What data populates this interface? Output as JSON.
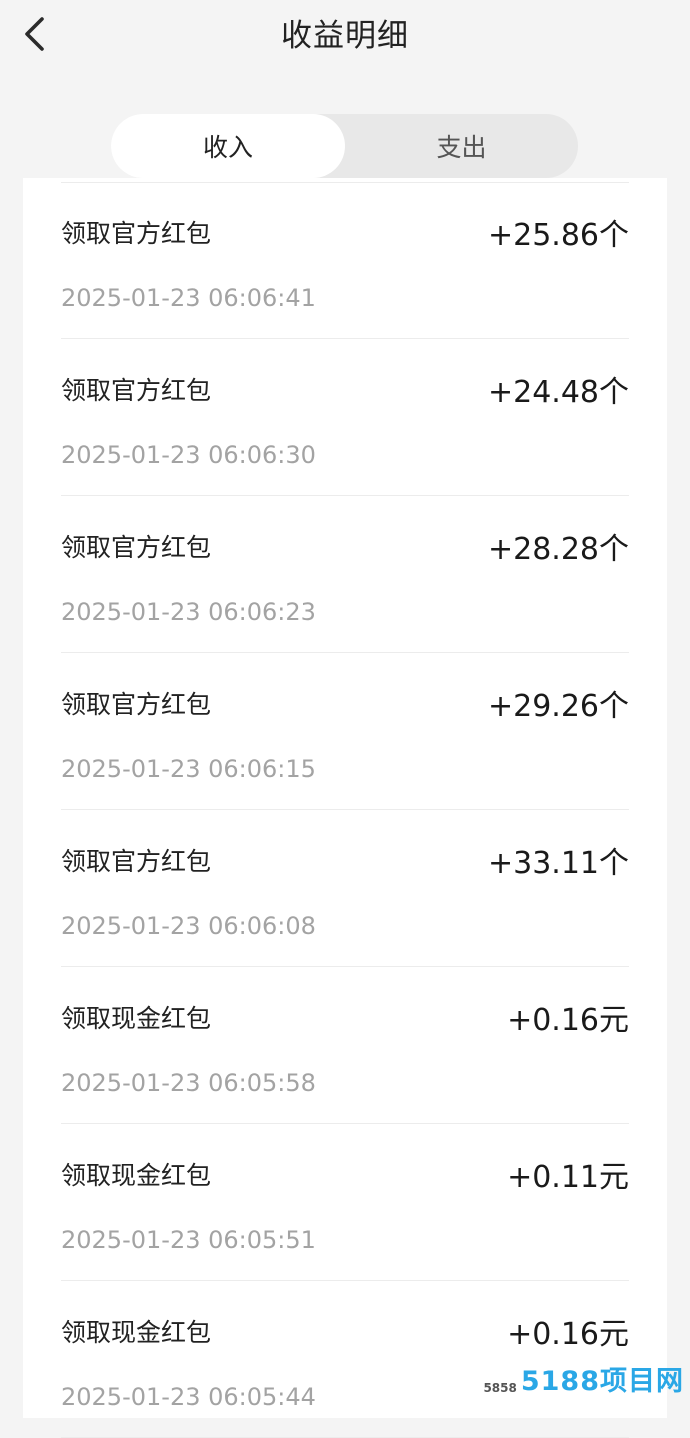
{
  "header": {
    "title": "收益明细",
    "back_icon": "chevron-left-icon"
  },
  "tabs": [
    {
      "label": "收入",
      "active": true
    },
    {
      "label": "支出",
      "active": false
    }
  ],
  "records": [
    {
      "title": "领取官方红包",
      "time": "2025-01-23 06:06:41",
      "amount": "+25.86个"
    },
    {
      "title": "领取官方红包",
      "time": "2025-01-23 06:06:30",
      "amount": "+24.48个"
    },
    {
      "title": "领取官方红包",
      "time": "2025-01-23 06:06:23",
      "amount": "+28.28个"
    },
    {
      "title": "领取官方红包",
      "time": "2025-01-23 06:06:15",
      "amount": "+29.26个"
    },
    {
      "title": "领取官方红包",
      "time": "2025-01-23 06:06:08",
      "amount": "+33.11个"
    },
    {
      "title": "领取现金红包",
      "time": "2025-01-23 06:05:58",
      "amount": "+0.16元"
    },
    {
      "title": "领取现金红包",
      "time": "2025-01-23 06:05:51",
      "amount": "+0.11元"
    },
    {
      "title": "领取现金红包",
      "time": "2025-01-23 06:05:44",
      "amount": "+0.16元"
    }
  ],
  "watermark": {
    "small": "5858",
    "big": "5188项目网"
  },
  "colors": {
    "background": "#f4f4f4",
    "card": "#ffffff",
    "tab_track": "#e8e8e8",
    "time_text": "#a3a3a3",
    "watermark": "#2aa7e6"
  }
}
